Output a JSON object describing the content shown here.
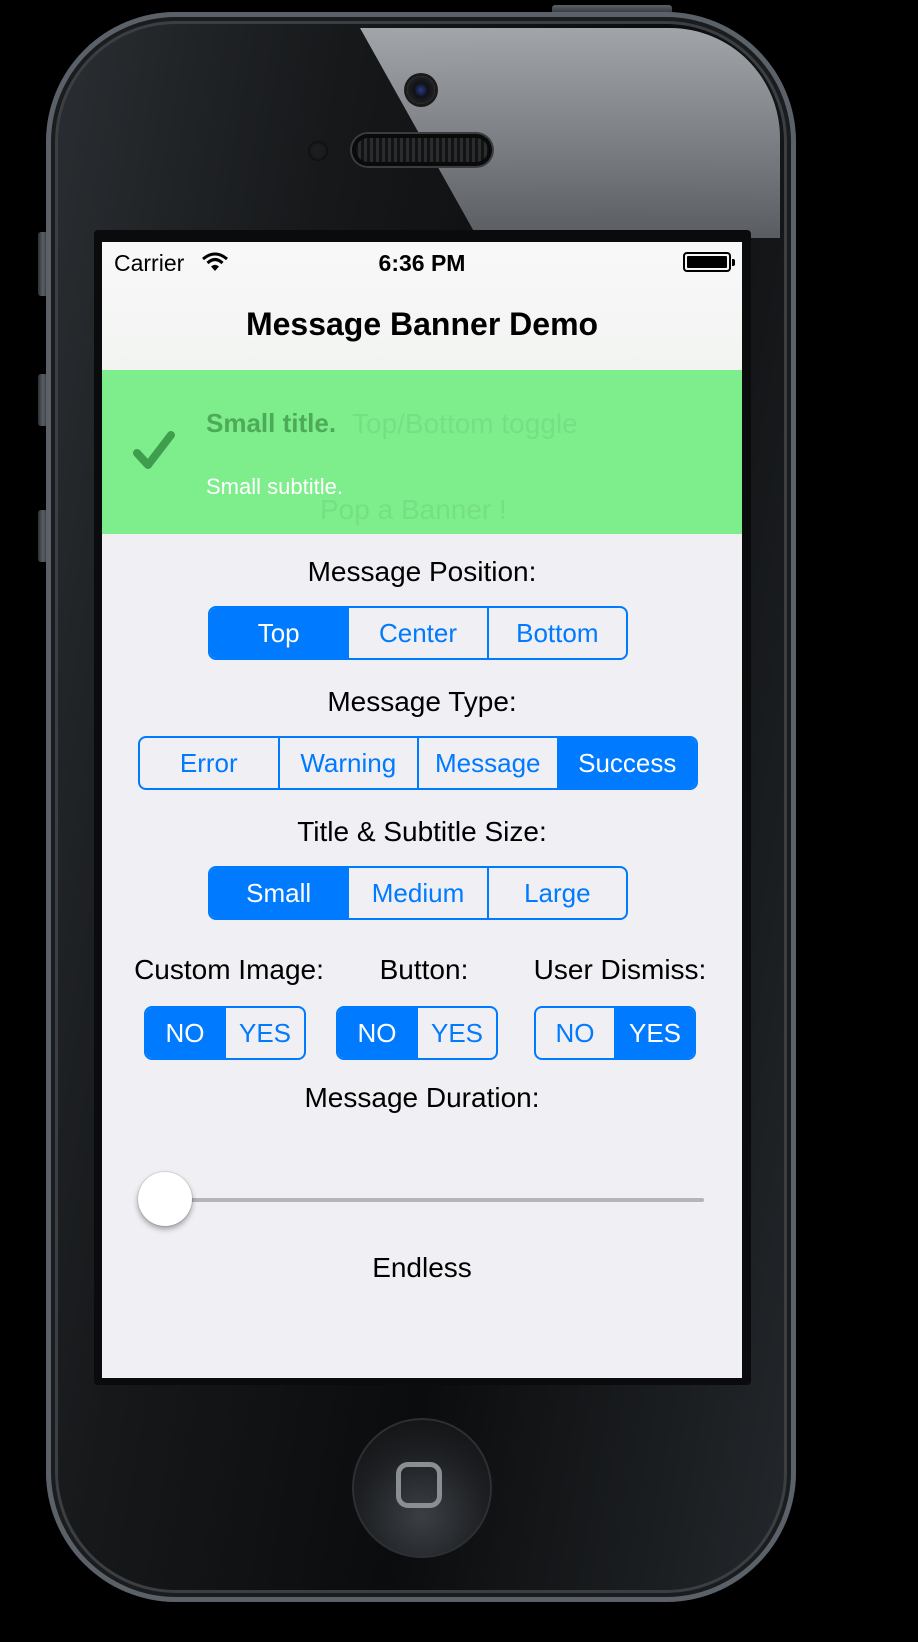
{
  "status_bar": {
    "carrier": "Carrier",
    "time": "6:36 PM",
    "wifi_icon": "wifi-icon",
    "battery_icon": "battery-icon",
    "battery_level": 1.0
  },
  "nav": {
    "title": "Message Banner Demo"
  },
  "banner": {
    "icon": "checkmark-icon",
    "title": "Small title.",
    "subtitle": "Small subtitle.",
    "behind_button_1": "Top/Bottom toggle",
    "behind_button_2": "Pop a Banner !",
    "background_color": "#7eed8c",
    "title_color": "#4daa59"
  },
  "message_position": {
    "label": "Message Position:",
    "options": [
      "Top",
      "Center",
      "Bottom"
    ],
    "selected": "Top"
  },
  "message_type": {
    "label": "Message Type:",
    "options": [
      "Error",
      "Warning",
      "Message",
      "Success"
    ],
    "selected": "Success"
  },
  "size": {
    "label": "Title & Subtitle Size:",
    "options": [
      "Small",
      "Medium",
      "Large"
    ],
    "selected": "Small"
  },
  "custom_image": {
    "label": "Custom Image:",
    "options": [
      "NO",
      "YES"
    ],
    "selected": "NO"
  },
  "button": {
    "label": "Button:",
    "options": [
      "NO",
      "YES"
    ],
    "selected": "NO"
  },
  "user_dismiss": {
    "label": "User Dismiss:",
    "options": [
      "NO",
      "YES"
    ],
    "selected": "YES"
  },
  "duration": {
    "label": "Message Duration:",
    "value_text": "Endless",
    "slider_fraction": 0.0
  },
  "colors": {
    "accent": "#007aff",
    "background": "#efeff4"
  }
}
